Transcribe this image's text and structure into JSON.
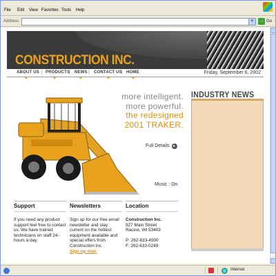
{
  "browser": {
    "menu": [
      "File",
      "Edit",
      "View",
      "Favorites",
      "Tools",
      "Help"
    ],
    "address_label": "Address",
    "address_value": "",
    "go_label": "Go",
    "status_zone": "Internet"
  },
  "site": {
    "brand": "CONSTRUCTION INC.",
    "nav": [
      "ABOUT US",
      "PRODUCTS",
      "NEWS",
      "CONTACT US",
      "HOME"
    ],
    "date": "Friday, September 6, 2002",
    "hero": {
      "line1": "more intelligent.",
      "line2": "more powerful.",
      "line3": "the redesigned",
      "line4": "2001 TRAKER.",
      "details": "Full Details",
      "music": "Music : On"
    },
    "news_title": "INDUSTRY NEWS",
    "support": {
      "title": "Support",
      "text": "If you need any product support feel free to contact us. We have trained technicians on staff 24-hours a day."
    },
    "newsletters": {
      "title": "Newsletters",
      "text": "Sign up for our free email newsletter and stay current on the hottest equipment available and special offers from Construction Inc.",
      "link": "Sign up now."
    },
    "location": {
      "company": "Construction Inc.",
      "title": "Location",
      "street": "927 Main Street",
      "city": "Racine, WI 53403",
      "phone": "P: 262-633-4500",
      "fax": "F: 262-633-0249"
    }
  },
  "colors": {
    "brand_orange": "#e8a21e",
    "news_box": "#f2d9b7",
    "header_dark": "#3a3a3a"
  }
}
